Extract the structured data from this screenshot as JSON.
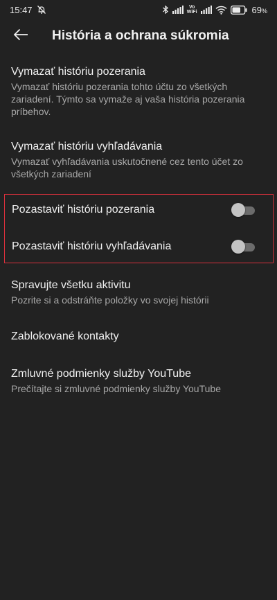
{
  "status_bar": {
    "time": "15:47",
    "battery_percent": "69",
    "battery_unit": "%",
    "vowifi_top": "Vo",
    "vowifi_bottom": "WiFi",
    "battery_level": 0.69,
    "icons": [
      "mute-bell-icon",
      "bluetooth-icon",
      "signal-icon",
      "signal-icon",
      "wifi-icon",
      "battery-icon"
    ]
  },
  "app_bar": {
    "title": "História a ochrana súkromia",
    "back_icon": "arrow-left-icon"
  },
  "items": {
    "clear_watch": {
      "title": "Vymazať históriu pozerania",
      "subtitle": "Vymazať históriu pozerania tohto účtu zo všetkých zariadení. Týmto sa vymaže aj vaša história pozerania príbehov."
    },
    "clear_search": {
      "title": "Vymazať históriu vyhľadávania",
      "subtitle": "Vymazať vyhľadávania uskutočnené cez tento účet zo všetkých zariadení"
    },
    "pause_watch": {
      "title": "Pozastaviť históriu pozerania",
      "enabled": false
    },
    "pause_search": {
      "title": "Pozastaviť históriu vyhľadávania",
      "enabled": false
    },
    "manage_activity": {
      "title": "Spravujte všetku aktivitu",
      "subtitle": "Pozrite si a odstráňte položky vo svojej histórii"
    },
    "blocked_contacts": {
      "title": "Zablokované kontakty"
    },
    "terms": {
      "title": "Zmluvné podmienky služby YouTube",
      "subtitle": "Prečítajte si zmluvné podmienky služby YouTube"
    }
  },
  "colors": {
    "background": "#222222",
    "highlight_border": "#d9303c",
    "subtitle_text": "#a8a8a8"
  }
}
